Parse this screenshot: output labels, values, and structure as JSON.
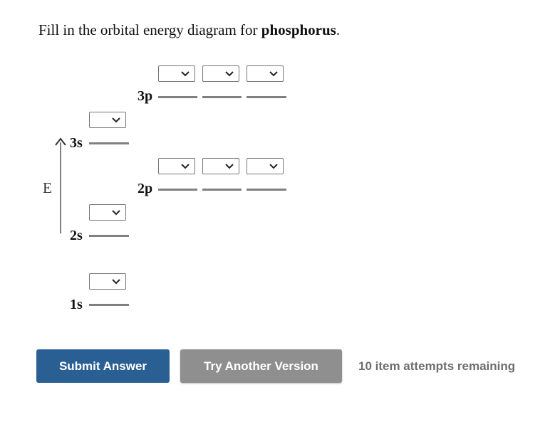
{
  "prompt": {
    "prefix": "Fill in the orbital energy diagram for ",
    "element": "phosphorus",
    "suffix": "."
  },
  "axis": {
    "label": "E"
  },
  "orbitals": {
    "1s": {
      "label": "1s",
      "selections": [
        ""
      ]
    },
    "2s": {
      "label": "2s",
      "selections": [
        ""
      ]
    },
    "2p": {
      "label": "2p",
      "selections": [
        "",
        "",
        ""
      ]
    },
    "3s": {
      "label": "3s",
      "selections": [
        ""
      ]
    },
    "3p": {
      "label": "3p",
      "selections": [
        "",
        "",
        ""
      ]
    }
  },
  "icons": {
    "dropdown": "chevron-down-icon",
    "arrow": "arrow-up-icon"
  },
  "buttons": {
    "submit": "Submit Answer",
    "try_another": "Try Another Version"
  },
  "status": {
    "attempts": "10 item attempts remaining"
  },
  "colors": {
    "submit_bg": "#2a5f93",
    "try_bg": "#8f8f8f",
    "line": "#808080"
  }
}
